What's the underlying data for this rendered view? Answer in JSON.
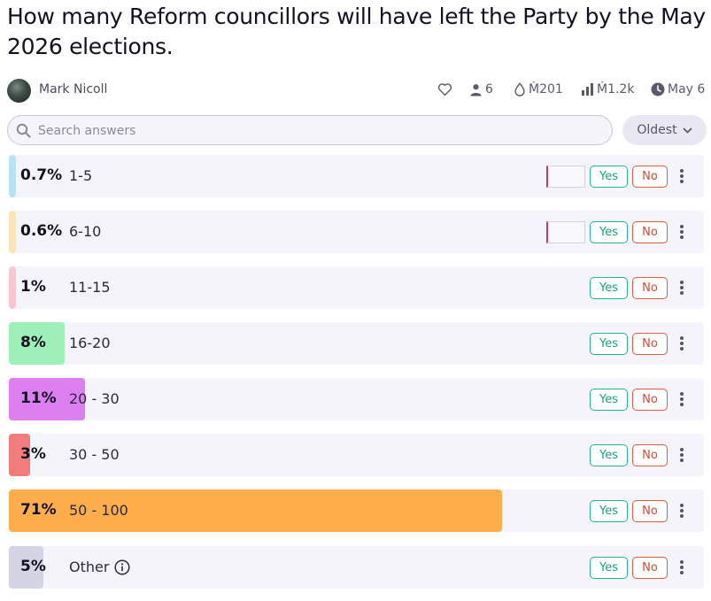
{
  "question": {
    "title": "How many Reform councillors will have left the Party by the May 2026 elections."
  },
  "meta": {
    "creator": "Mark Nicoll",
    "traders": "6",
    "volume": "Ṁ201",
    "liquidity": "Ṁ1.2k",
    "close_date": "May 6"
  },
  "search": {
    "placeholder": "Search answers"
  },
  "sort": {
    "label": "Oldest"
  },
  "buttons": {
    "yes": "Yes",
    "no": "No"
  },
  "answers": [
    {
      "percent": "0.7%",
      "label": "1-5",
      "probability": 0.7,
      "color": "#b7e4f5",
      "has_position": true
    },
    {
      "percent": "0.6%",
      "label": "6-10",
      "probability": 0.6,
      "color": "#fbe6b3",
      "has_position": true
    },
    {
      "percent": "1%",
      "label": "11-15",
      "probability": 1,
      "color": "#fbc6d2",
      "has_position": false
    },
    {
      "percent": "8%",
      "label": "16-20",
      "probability": 8,
      "color": "#9ef0b8",
      "has_position": false
    },
    {
      "percent": "11%",
      "label": "20 - 30",
      "probability": 11,
      "color": "#dd7ff0",
      "has_position": false
    },
    {
      "percent": "3%",
      "label": "30 - 50",
      "probability": 3,
      "color": "#f27b7b",
      "has_position": false
    },
    {
      "percent": "71%",
      "label": "50 - 100",
      "probability": 71,
      "color": "#ffae4b",
      "has_position": false
    },
    {
      "percent": "5%",
      "label": "Other",
      "probability": 5,
      "color": "#d4d4e4",
      "has_position": false,
      "info_icon": "info-icon"
    }
  ],
  "icons": {
    "avatar": "avatar-image",
    "follow": "heart-icon",
    "traders": "user-icon",
    "volume": "droplet-icon",
    "liquidity": "bar-chart-icon",
    "close": "clock-icon",
    "search": "search-icon",
    "sort": "chevron-down-icon",
    "more": "more-vertical-icon"
  }
}
